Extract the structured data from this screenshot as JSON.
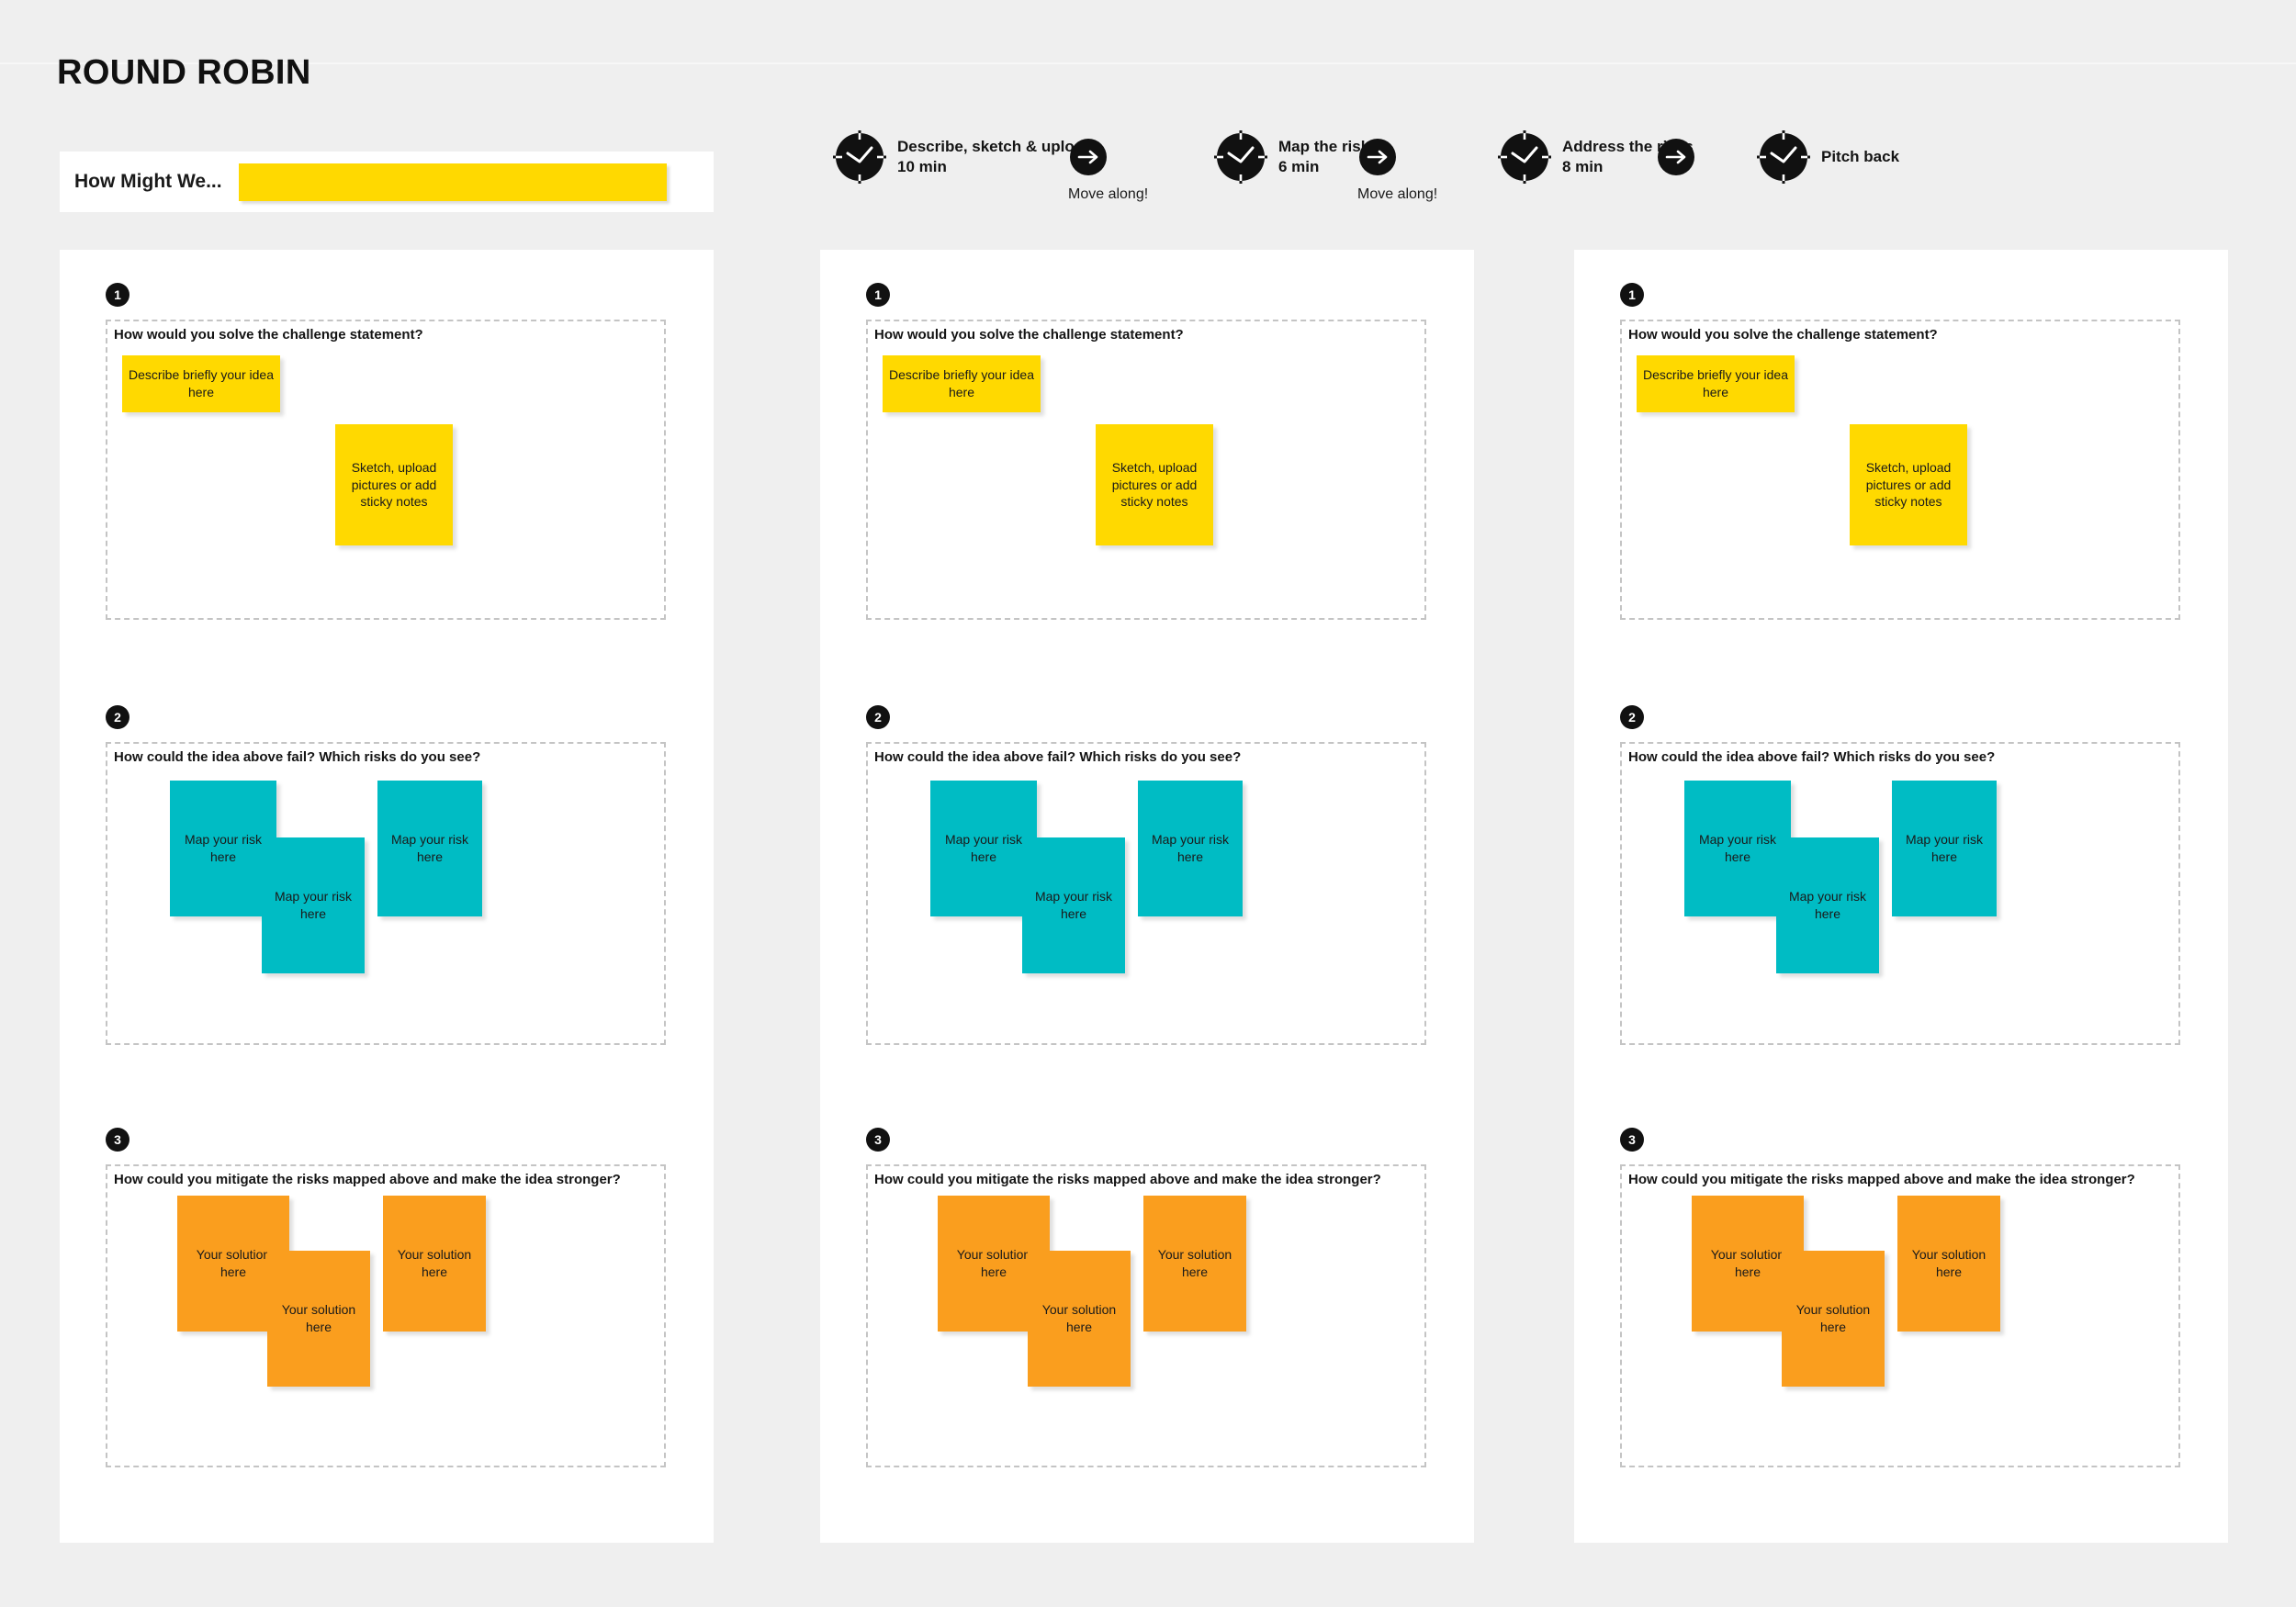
{
  "board": {
    "title": "ROUND ROBIN"
  },
  "hmw": {
    "label": "How Might We...",
    "value": "",
    "placeholder": ""
  },
  "timeline": {
    "steps": [
      {
        "icon": "clock-icon",
        "name": "Describe, sketch & upload",
        "time": "10 min"
      },
      {
        "icon": "clock-icon",
        "name": "Map the risks",
        "time": "6 min"
      },
      {
        "icon": "clock-icon",
        "name": "Address the risks",
        "time": "8 min"
      },
      {
        "icon": "clock-icon",
        "name": "Pitch back",
        "time": ""
      }
    ],
    "arrows": [
      {
        "icon": "arrow-right-icon",
        "caption": "Move along!"
      },
      {
        "icon": "arrow-right-icon",
        "caption": "Move along!"
      },
      {
        "icon": "arrow-right-icon",
        "caption": ""
      }
    ]
  },
  "sections": [
    {
      "number": "1",
      "prompt": "How would you solve the challenge statement?",
      "notes": [
        {
          "text": "Describe briefly your idea here",
          "color": "#ffd900"
        },
        {
          "text": "Sketch, upload pictures or add sticky notes",
          "color": "#ffd900"
        }
      ]
    },
    {
      "number": "2",
      "prompt": "How could the idea above fail? Which risks do you see?",
      "notes": [
        {
          "text": "Map your risk here",
          "color": "#00bcc4"
        },
        {
          "text": "Map your risk here",
          "color": "#00bcc4"
        },
        {
          "text": "Map your risk here",
          "color": "#00bcc4"
        }
      ]
    },
    {
      "number": "3",
      "prompt": "How could you mitigate the risks mapped above and make the idea stronger?",
      "notes": [
        {
          "text": "Your solution here",
          "color": "#fa9e1e"
        },
        {
          "text": "Your solution here",
          "color": "#fa9e1e"
        },
        {
          "text": "Your solution here",
          "color": "#fa9e1e"
        }
      ]
    }
  ],
  "columns": [
    {
      "name": "participant-column-1"
    },
    {
      "name": "participant-column-2"
    },
    {
      "name": "participant-column-3"
    }
  ],
  "colors": {
    "background": "#efefef",
    "card": "#ffffff",
    "yellow": "#ffd900",
    "teal": "#00bcc4",
    "orange": "#fa9e1e",
    "ink": "#111111",
    "dashed_border": "#c4c4c4"
  }
}
